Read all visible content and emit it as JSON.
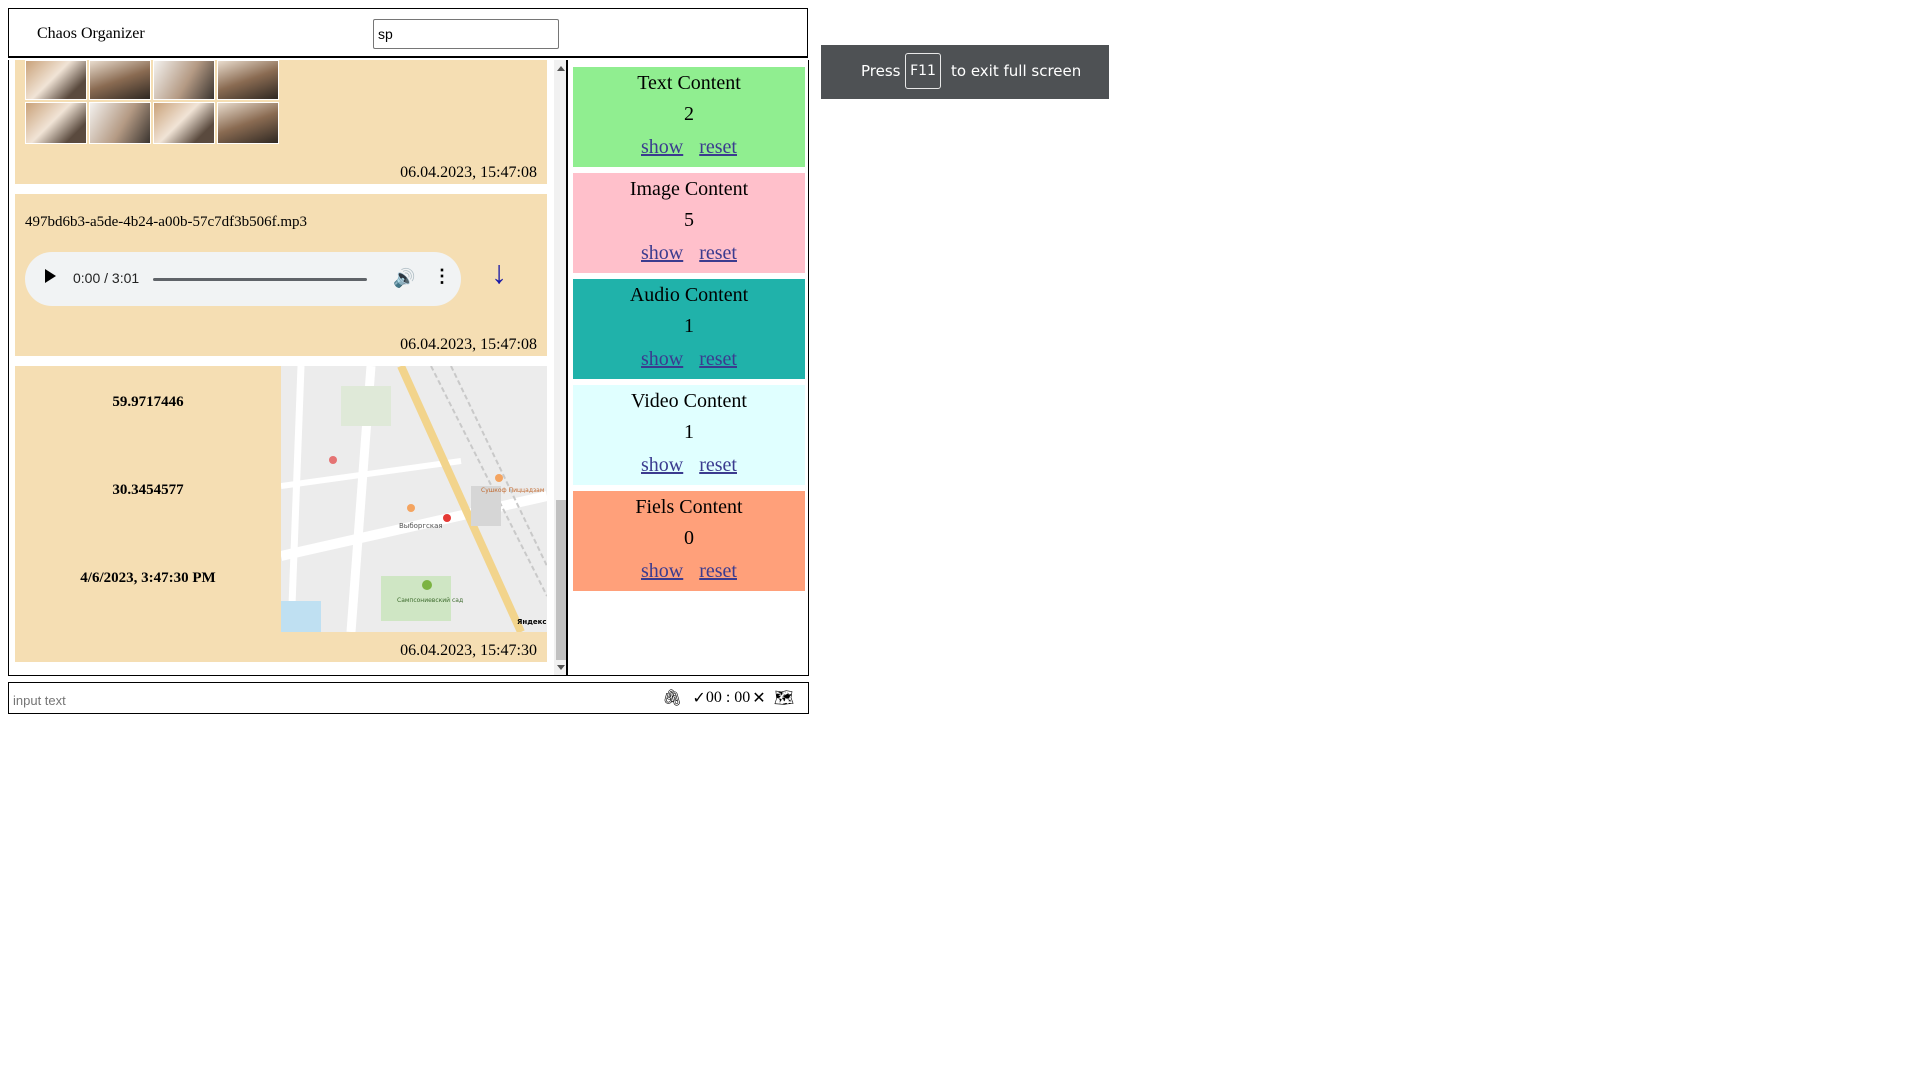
{
  "header": {
    "title": "Chaos Organizer",
    "search_value": "sp"
  },
  "feed": {
    "image_post": {
      "thumbnail_count": 8,
      "timestamp": "06.04.2023, 15:47:08"
    },
    "audio_post": {
      "filename": "497bd6b3-a5de-4b24-a00b-57c7df3b506f.mp3",
      "player_time": "0:00 / 3:01",
      "download_icon": "down-arrow-icon",
      "timestamp": "06.04.2023, 15:47:08"
    },
    "geo_post": {
      "latitude": "59.9717446",
      "longitude": "30.3454577",
      "datetime": "4/6/2023, 3:47:30 PM",
      "map_labels": {
        "metro": "Выборгская",
        "park": "Сампсониевский сад",
        "cafe": "Сушкоф Пиццадзам",
        "brand": "Яндекс"
      },
      "timestamp": "06.04.2023, 15:47:30"
    }
  },
  "stats": [
    {
      "label": "Text Content",
      "count": "2",
      "show": "show",
      "reset": "reset",
      "color": "#90ee90"
    },
    {
      "label": "Image Content",
      "count": "5",
      "show": "show",
      "reset": "reset",
      "color": "#ffc0cb"
    },
    {
      "label": "Audio Content",
      "count": "1",
      "show": "show",
      "reset": "reset",
      "color": "#20b2aa"
    },
    {
      "label": "Video Content",
      "count": "1",
      "show": "show",
      "reset": "reset",
      "color": "#e0ffff"
    },
    {
      "label": "Fiels Content",
      "count": "0",
      "show": "show",
      "reset": "reset",
      "color": "#ffa07a"
    }
  ],
  "input_bar": {
    "placeholder": "input text",
    "timer": "00 : 00",
    "icons": [
      "paperclip-icon",
      "checkmark-icon",
      "close-icon",
      "map-icon"
    ]
  },
  "fullscreen_toast": {
    "before": "Press",
    "key": "F11",
    "after": "to exit full screen"
  }
}
